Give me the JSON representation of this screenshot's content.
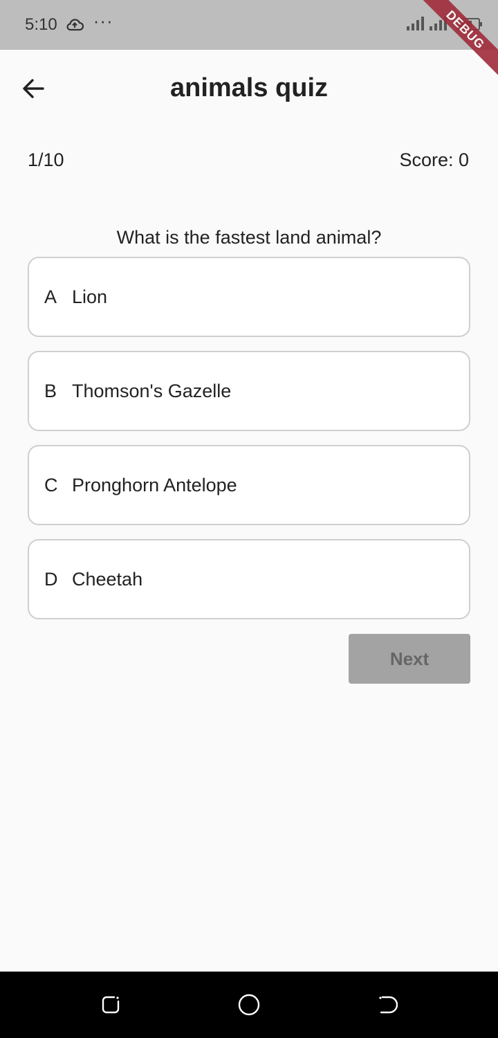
{
  "status_bar": {
    "time": "5:10",
    "dots": "···",
    "debug_label": "DEBUG",
    "icons": [
      "cloud-upload-icon",
      "signal-icon",
      "signal-4g-icon",
      "battery-icon"
    ]
  },
  "app_bar": {
    "title": "animals quiz",
    "back_icon": "arrow-back-icon"
  },
  "quiz": {
    "progress": "1/10",
    "score": "Score: 0",
    "question": "What is the fastest land animal?",
    "options": [
      {
        "letter": "A",
        "text": "Lion"
      },
      {
        "letter": "B",
        "text": "Thomson's Gazelle"
      },
      {
        "letter": "C",
        "text": "Pronghorn Antelope"
      },
      {
        "letter": "D",
        "text": "Cheetah"
      }
    ],
    "next_label": "Next"
  },
  "nav_bar": {
    "icons": [
      "recent-apps-icon",
      "home-icon",
      "back-nav-icon"
    ]
  },
  "colors": {
    "background": "#fafafa",
    "status_bar": "#bdbdbd",
    "option_border": "#cfcfcf",
    "next_button_bg": "#a3a3a3",
    "next_button_text": "#666666",
    "debug_ribbon": "#a12b3a"
  }
}
